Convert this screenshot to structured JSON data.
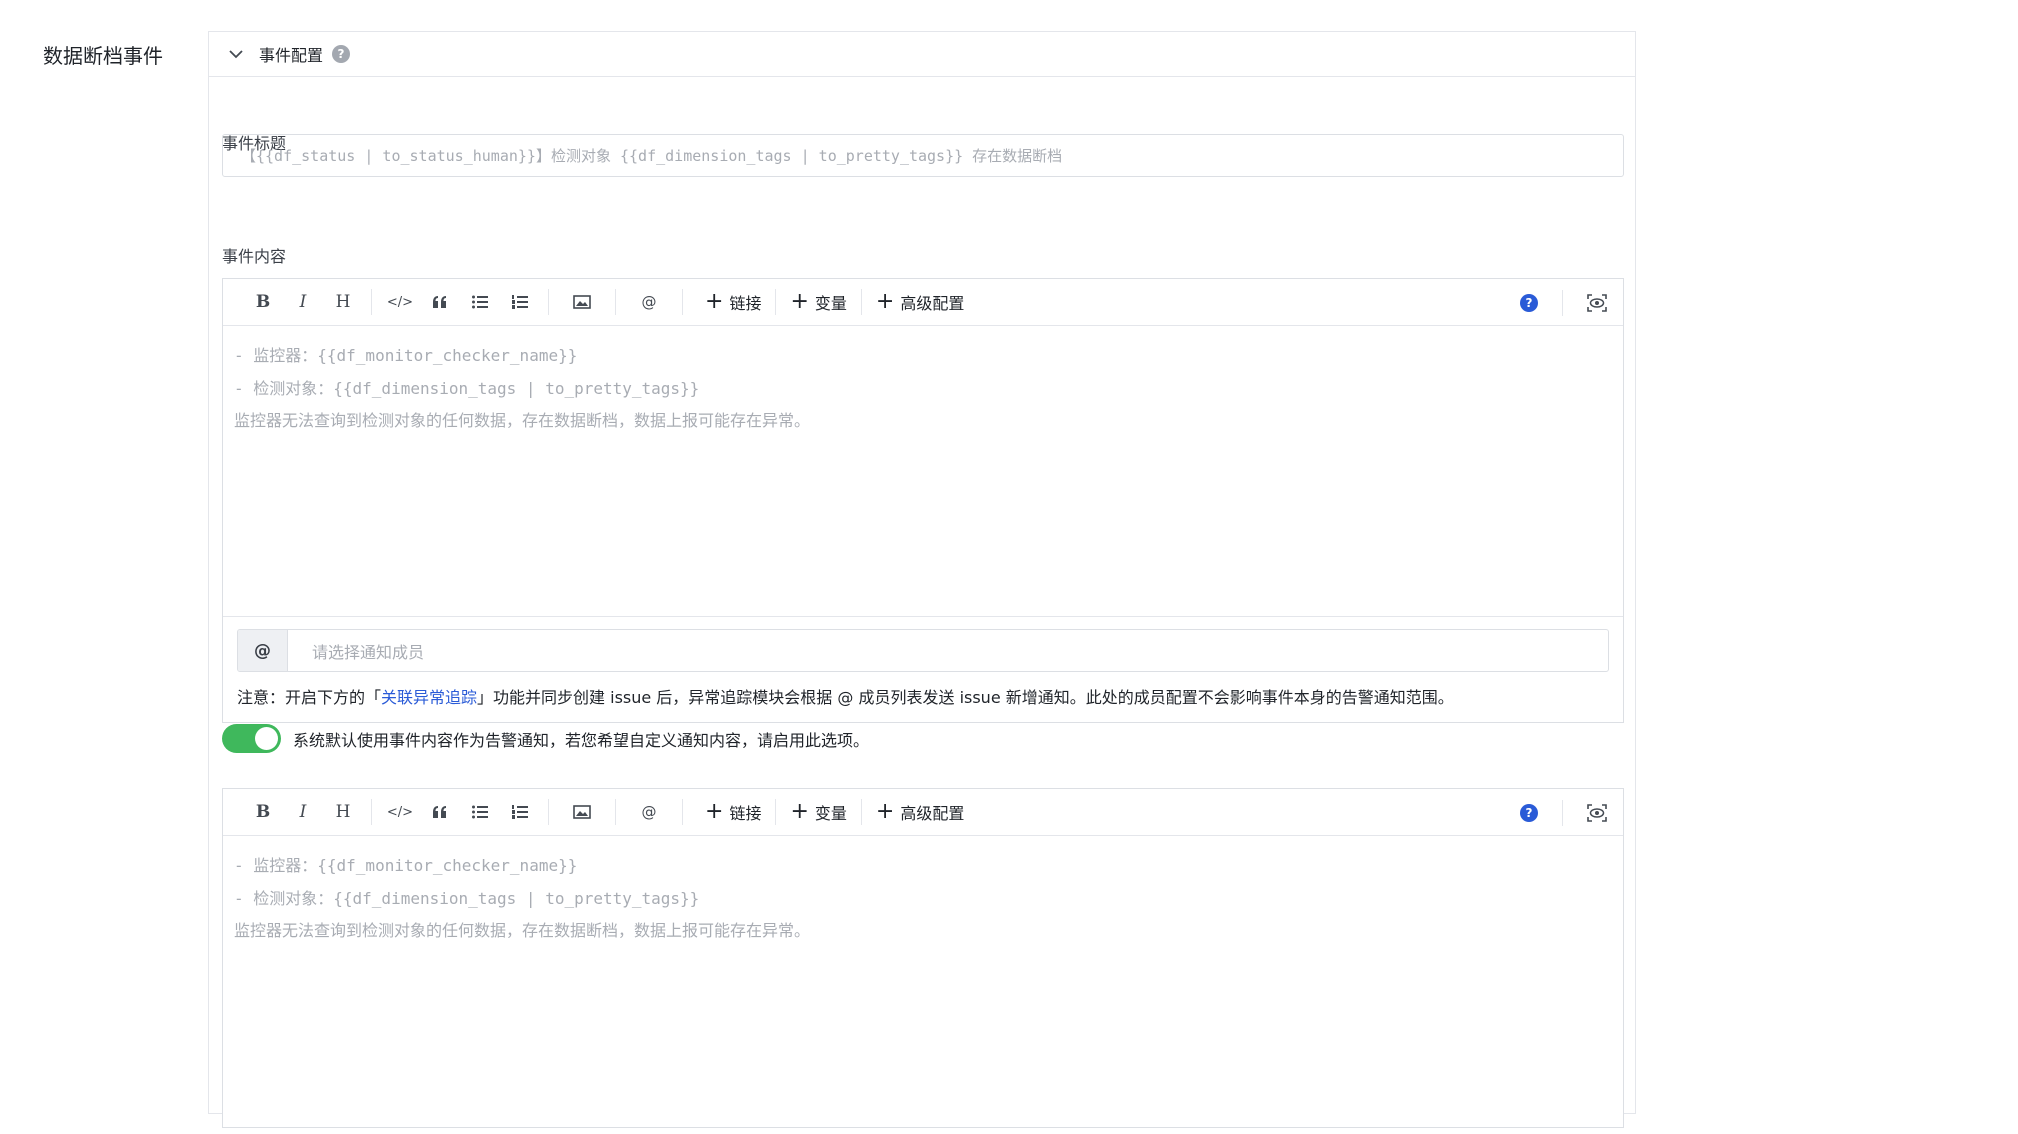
{
  "section": {
    "label": "数据断档事件"
  },
  "panel": {
    "title": "事件配置",
    "help_icon": "question-icon"
  },
  "event_title": {
    "label": "事件标题",
    "placeholder": "【{{df_status | to_status_human}}】检测对象 {{df_dimension_tags | to_pretty_tags}} 存在数据断档"
  },
  "event_content": {
    "label": "事件内容"
  },
  "toolbar": {
    "bold": "B",
    "italic": "I",
    "heading": "H",
    "code": "</>",
    "quote": "66",
    "mention": "@",
    "link": "链接",
    "variable": "变量",
    "advanced": "高级配置",
    "plus": "+"
  },
  "editor1": {
    "lines": [
      "- 监控器：{{df_monitor_checker_name}}",
      "- 检测对象：{{df_dimension_tags | to_pretty_tags}}",
      "监控器无法查询到检测对象的任何数据，存在数据断档，数据上报可能存在异常。"
    ]
  },
  "notify": {
    "at": "@",
    "placeholder": "请选择通知成员",
    "notice_prefix": "注意：开启下方的「",
    "notice_link": "关联异常追踪",
    "notice_suffix": "」功能并同步创建 issue 后，异常追踪模块会根据 @ 成员列表发送 issue 新增通知。此处的成员配置不会影响事件本身的告警通知范围。"
  },
  "custom_notify": {
    "enabled": true,
    "label": "系统默认使用事件内容作为告警通知，若您希望自定义通知内容，请启用此选项。"
  },
  "editor2": {
    "lines": [
      "- 监控器：{{df_monitor_checker_name}}",
      "- 检测对象：{{df_dimension_tags | to_pretty_tags}}",
      "监控器无法查询到检测对象的任何数据，存在数据断档，数据上报可能存在异常。"
    ]
  },
  "colors": {
    "accent": "#2a5bd7",
    "toggle_on": "#3fb85c",
    "placeholder": "#a8acb3"
  }
}
